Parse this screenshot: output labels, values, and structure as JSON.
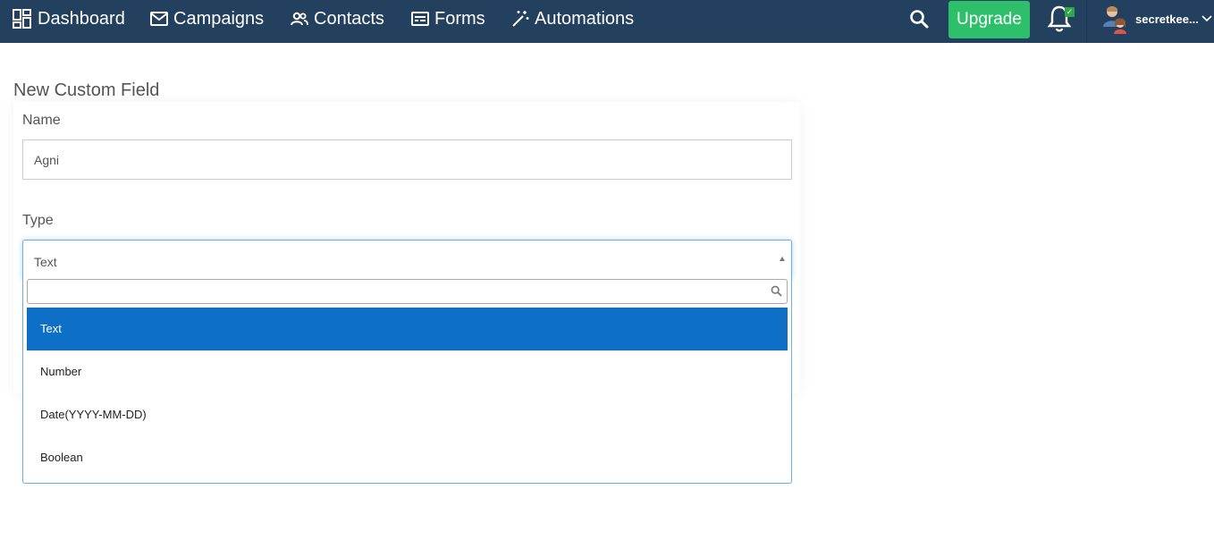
{
  "nav": {
    "items": [
      {
        "label": "Dashboard",
        "icon": "dashboard-icon"
      },
      {
        "label": "Campaigns",
        "icon": "envelope-icon"
      },
      {
        "label": "Contacts",
        "icon": "people-icon"
      },
      {
        "label": "Forms",
        "icon": "form-icon"
      },
      {
        "label": "Automations",
        "icon": "magic-wand-icon"
      }
    ],
    "upgrade_label": "Upgrade",
    "notification_badge": "✓",
    "username": "secretkee..."
  },
  "page": {
    "title": "New Custom Field"
  },
  "form": {
    "name_label": "Name",
    "name_value": "Agni",
    "type_label": "Type",
    "type_selected": "Text",
    "search_value": "",
    "options": [
      "Text",
      "Number",
      "Date(YYYY-MM-DD)",
      "Boolean"
    ]
  },
  "colors": {
    "nav_bg": "#24405f",
    "upgrade_bg": "#2dbf6a",
    "selected_option_bg": "#0e6fc7",
    "focus_border": "#66afe9"
  }
}
